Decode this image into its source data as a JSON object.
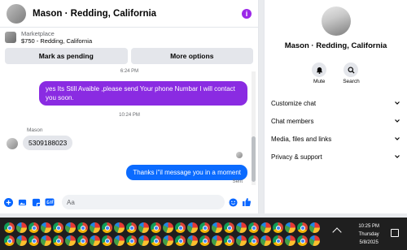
{
  "chat": {
    "title": "Mason · Redding, California",
    "marketplace_label": "Marketplace",
    "marketplace_detail": "$750 - Redding, California",
    "mark_pending": "Mark as pending",
    "more_options": "More options"
  },
  "messages": {
    "timestamp1": "6:24 PM",
    "msg1": "yes Its Still Avaible ,please send Your phone Numbar I will contact you soon.",
    "timestamp2": "10:24 PM",
    "sender": "Mason",
    "msg2": "5309188023",
    "msg3": "Thanks i\"il message you in a moment",
    "sent": "Sent"
  },
  "composer": {
    "placeholder": "Aa"
  },
  "info": {
    "name": "Mason · Redding, California",
    "mute": "Mute",
    "search": "Search",
    "menu": [
      "Customize chat",
      "Chat members",
      "Media, files and links",
      "Privacy & support"
    ]
  },
  "taskbar": {
    "time": "10:25 PM",
    "day": "Thursday",
    "date": "5/8/2025"
  },
  "colors": {
    "accent": "#0866ff",
    "purple": "#9b27e8",
    "outgoing1": "#8a2be2",
    "outgoing2": "#0b6bff"
  }
}
